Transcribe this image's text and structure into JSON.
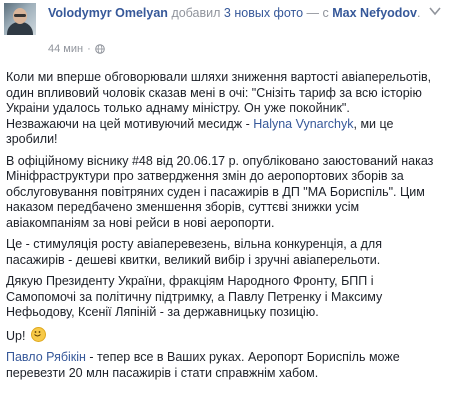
{
  "header": {
    "author": "Volodymyr Omelyan",
    "added_text": "добавил",
    "photos_link": "3 новых фото",
    "with_text": "— с",
    "with_name": "Max Nefyodov",
    "with_suffix": ".",
    "time": "44 мин",
    "globe_icon": "globe-icon",
    "chevron_icon": "chevron-down-icon"
  },
  "post": {
    "p1_line": "Коли ми вперше обговорювали шляхи зниження вартості авіаперельотів, один впливовий чоловік сказав мені в очі: \"Снізіть тариф за всю історію Украіни удалось только аднаму міністру. Он уже покойник\".",
    "p1_tail_before": "Незважаючи на цей мотивуючий месидж - ",
    "p1_mention": "Halyna Vynarchyk",
    "p1_tail_after": ", ми це зробили!",
    "p2": "В офіційному віснику #48 від 20.06.17 р. опубліковано заюстований наказ Мініфраструктури про затвердження змін до аеропортових зборів за обслуговування повітряних суден і пасажирів в ДП \"МА Бориспіль\". Цим наказом передбачено зменшення зборів, суттєві знижки усім авіакомпаніям за нові рейси в нові аеропорти.",
    "p3": "Це - стимуляція росту авіаперевезень, вільна конкуренція, а для пасажирів - дешеві квитки, великий вибір і зручні авіаперельоти.",
    "p4": "Дякую Президенту України, фракціям Народного Фронту, БПП і Самопомочі за політичну підтримку, а Павлу Петренку і Максиму Нефьодову, Ксенії Ляпіній - за державницьку позицію.",
    "p5": "Up!",
    "p5_emoji": "smile-emoji",
    "p6_mention": "Павло Рябікін",
    "p6_rest": " - тепер все в Ваших руках. Аеропорт Бориспіль може перевезти 20 млн пасажирів і стати справжнім хабом."
  },
  "colors": {
    "link": "#365899",
    "meta": "#90949c",
    "text": "#1d2129"
  }
}
